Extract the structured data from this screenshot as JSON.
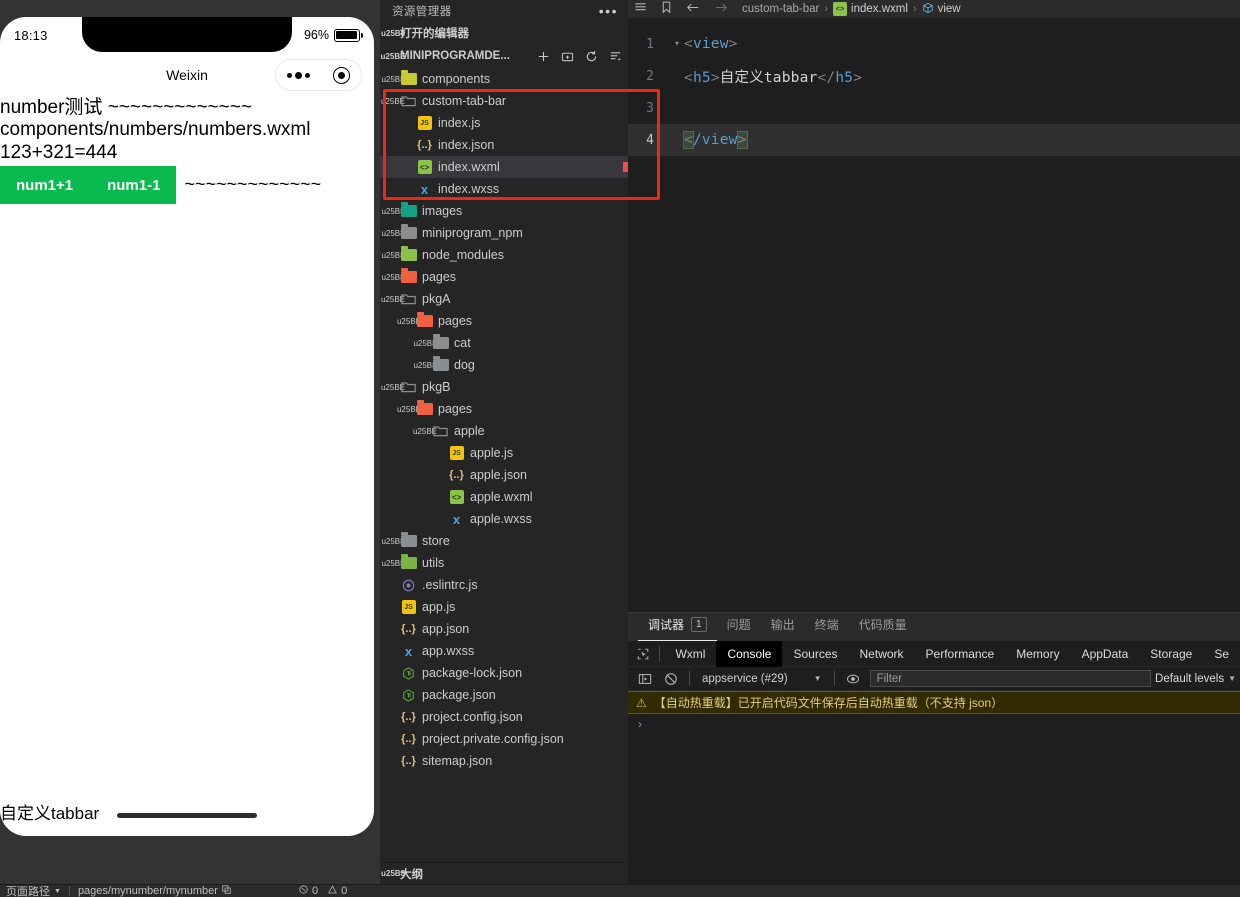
{
  "simulator": {
    "status_time": "18:13",
    "battery_percent": "96%",
    "nav_title": "Weixin",
    "page_lines": [
      "number测试 ~~~~~~~~~~~~~",
      "components/numbers/numbers.wxml",
      "123+321=444"
    ],
    "buttons": {
      "increment": "num1+1",
      "decrement": "num1-1"
    },
    "trailing_tildes": "~~~~~~~~~~~~~",
    "tabbar_label": "自定义tabbar"
  },
  "explorer": {
    "title": "资源管理器",
    "more_label": "•••",
    "open_editors": "打开的编辑器",
    "project_name": "MINIPROGRAMDE...",
    "outline": "大纲",
    "tree": [
      {
        "label": "components",
        "depth": 1,
        "kind": "folder-yellow",
        "state": "collapsed"
      },
      {
        "label": "custom-tab-bar",
        "depth": 1,
        "kind": "folder-open",
        "state": "expanded"
      },
      {
        "label": "index.js",
        "depth": 2,
        "kind": "js",
        "state": "none"
      },
      {
        "label": "index.json",
        "depth": 2,
        "kind": "json",
        "state": "none"
      },
      {
        "label": "index.wxml",
        "depth": 2,
        "kind": "wxml",
        "state": "none",
        "selected": true
      },
      {
        "label": "index.wxss",
        "depth": 2,
        "kind": "wxss",
        "state": "none"
      },
      {
        "label": "images",
        "depth": 1,
        "kind": "folder-teal",
        "state": "collapsed"
      },
      {
        "label": "miniprogram_npm",
        "depth": 1,
        "kind": "folder-gray",
        "state": "collapsed"
      },
      {
        "label": "node_modules",
        "depth": 1,
        "kind": "folder-green",
        "state": "collapsed"
      },
      {
        "label": "pages",
        "depth": 1,
        "kind": "folder-red",
        "state": "collapsed"
      },
      {
        "label": "pkgA",
        "depth": 1,
        "kind": "folder-open",
        "state": "expanded"
      },
      {
        "label": "pages",
        "depth": 2,
        "kind": "folder-red",
        "state": "expanded"
      },
      {
        "label": "cat",
        "depth": 3,
        "kind": "folder-gray",
        "state": "collapsed"
      },
      {
        "label": "dog",
        "depth": 3,
        "kind": "folder-gray",
        "state": "collapsed"
      },
      {
        "label": "pkgB",
        "depth": 1,
        "kind": "folder-open",
        "state": "expanded"
      },
      {
        "label": "pages",
        "depth": 2,
        "kind": "folder-red",
        "state": "expanded"
      },
      {
        "label": "apple",
        "depth": 3,
        "kind": "folder-open",
        "state": "expanded"
      },
      {
        "label": "apple.js",
        "depth": 4,
        "kind": "js",
        "state": "none"
      },
      {
        "label": "apple.json",
        "depth": 4,
        "kind": "json",
        "state": "none"
      },
      {
        "label": "apple.wxml",
        "depth": 4,
        "kind": "wxml",
        "state": "none"
      },
      {
        "label": "apple.wxss",
        "depth": 4,
        "kind": "wxss",
        "state": "none"
      },
      {
        "label": "store",
        "depth": 1,
        "kind": "folder-gray",
        "state": "collapsed"
      },
      {
        "label": "utils",
        "depth": 1,
        "kind": "folder-lgreen",
        "state": "collapsed"
      },
      {
        "label": ".eslintrc.js",
        "depth": 1,
        "kind": "eslint",
        "state": "none"
      },
      {
        "label": "app.js",
        "depth": 1,
        "kind": "js",
        "state": "none"
      },
      {
        "label": "app.json",
        "depth": 1,
        "kind": "json",
        "state": "none"
      },
      {
        "label": "app.wxss",
        "depth": 1,
        "kind": "wxss",
        "state": "none"
      },
      {
        "label": "package-lock.json",
        "depth": 1,
        "kind": "npm",
        "state": "none"
      },
      {
        "label": "package.json",
        "depth": 1,
        "kind": "npm",
        "state": "none"
      },
      {
        "label": "project.config.json",
        "depth": 1,
        "kind": "json",
        "state": "none"
      },
      {
        "label": "project.private.config.json",
        "depth": 1,
        "kind": "json",
        "state": "none"
      },
      {
        "label": "sitemap.json",
        "depth": 1,
        "kind": "json",
        "state": "none"
      }
    ]
  },
  "editor": {
    "breadcrumb": {
      "folder": "custom-tab-bar",
      "file": "index.wxml",
      "symbol": "view",
      "separator": "›"
    },
    "lines": [
      {
        "num": "1",
        "parts": [
          {
            "t": "punc",
            "v": "<"
          },
          {
            "t": "tag",
            "v": "view"
          },
          {
            "t": "punc",
            "v": ">"
          }
        ],
        "fold": true
      },
      {
        "num": "2",
        "parts": [
          {
            "t": "punc",
            "v": "<"
          },
          {
            "t": "tag",
            "v": "h5"
          },
          {
            "t": "punc",
            "v": ">"
          },
          {
            "t": "cn",
            "v": "自定义tabbar"
          },
          {
            "t": "punc",
            "v": "</"
          },
          {
            "t": "tag",
            "v": "h5"
          },
          {
            "t": "punc",
            "v": ">"
          }
        ],
        "fold": false
      },
      {
        "num": "3",
        "parts": [],
        "fold": false
      },
      {
        "num": "4",
        "parts": [
          {
            "t": "punc",
            "v": "<"
          },
          {
            "t": "tag",
            "v": "/view"
          },
          {
            "t": "punc",
            "v": ">"
          }
        ],
        "fold": false,
        "active": true
      }
    ]
  },
  "devtools": {
    "panel_tabs": [
      {
        "label": "调试器",
        "count": "1",
        "active": true
      },
      {
        "label": "问题",
        "active": false
      },
      {
        "label": "输出",
        "active": false
      },
      {
        "label": "终端",
        "active": false
      },
      {
        "label": "代码质量",
        "active": false
      }
    ],
    "tabs": [
      {
        "label": "Wxml",
        "active": false
      },
      {
        "label": "Console",
        "active": true
      },
      {
        "label": "Sources",
        "active": false
      },
      {
        "label": "Network",
        "active": false
      },
      {
        "label": "Performance",
        "active": false
      },
      {
        "label": "Memory",
        "active": false
      },
      {
        "label": "AppData",
        "active": false
      },
      {
        "label": "Storage",
        "active": false
      },
      {
        "label": "Se",
        "active": false
      }
    ],
    "context": "appservice (#29)",
    "filter_placeholder": "Filter",
    "levels": "Default levels",
    "warning": "【自动热重载】已开启代码文件保存后自动热重载（不支持 json）",
    "prompt": "›"
  },
  "statusbar": {
    "page_path_label": "页面路径",
    "page_path_value": "pages/mynumber/mynumber",
    "errors": "0",
    "warnings": "0"
  },
  "colors": {
    "accent_green": "#09bb4f",
    "annotation_red": "#f22613",
    "selection": "#37373d"
  }
}
